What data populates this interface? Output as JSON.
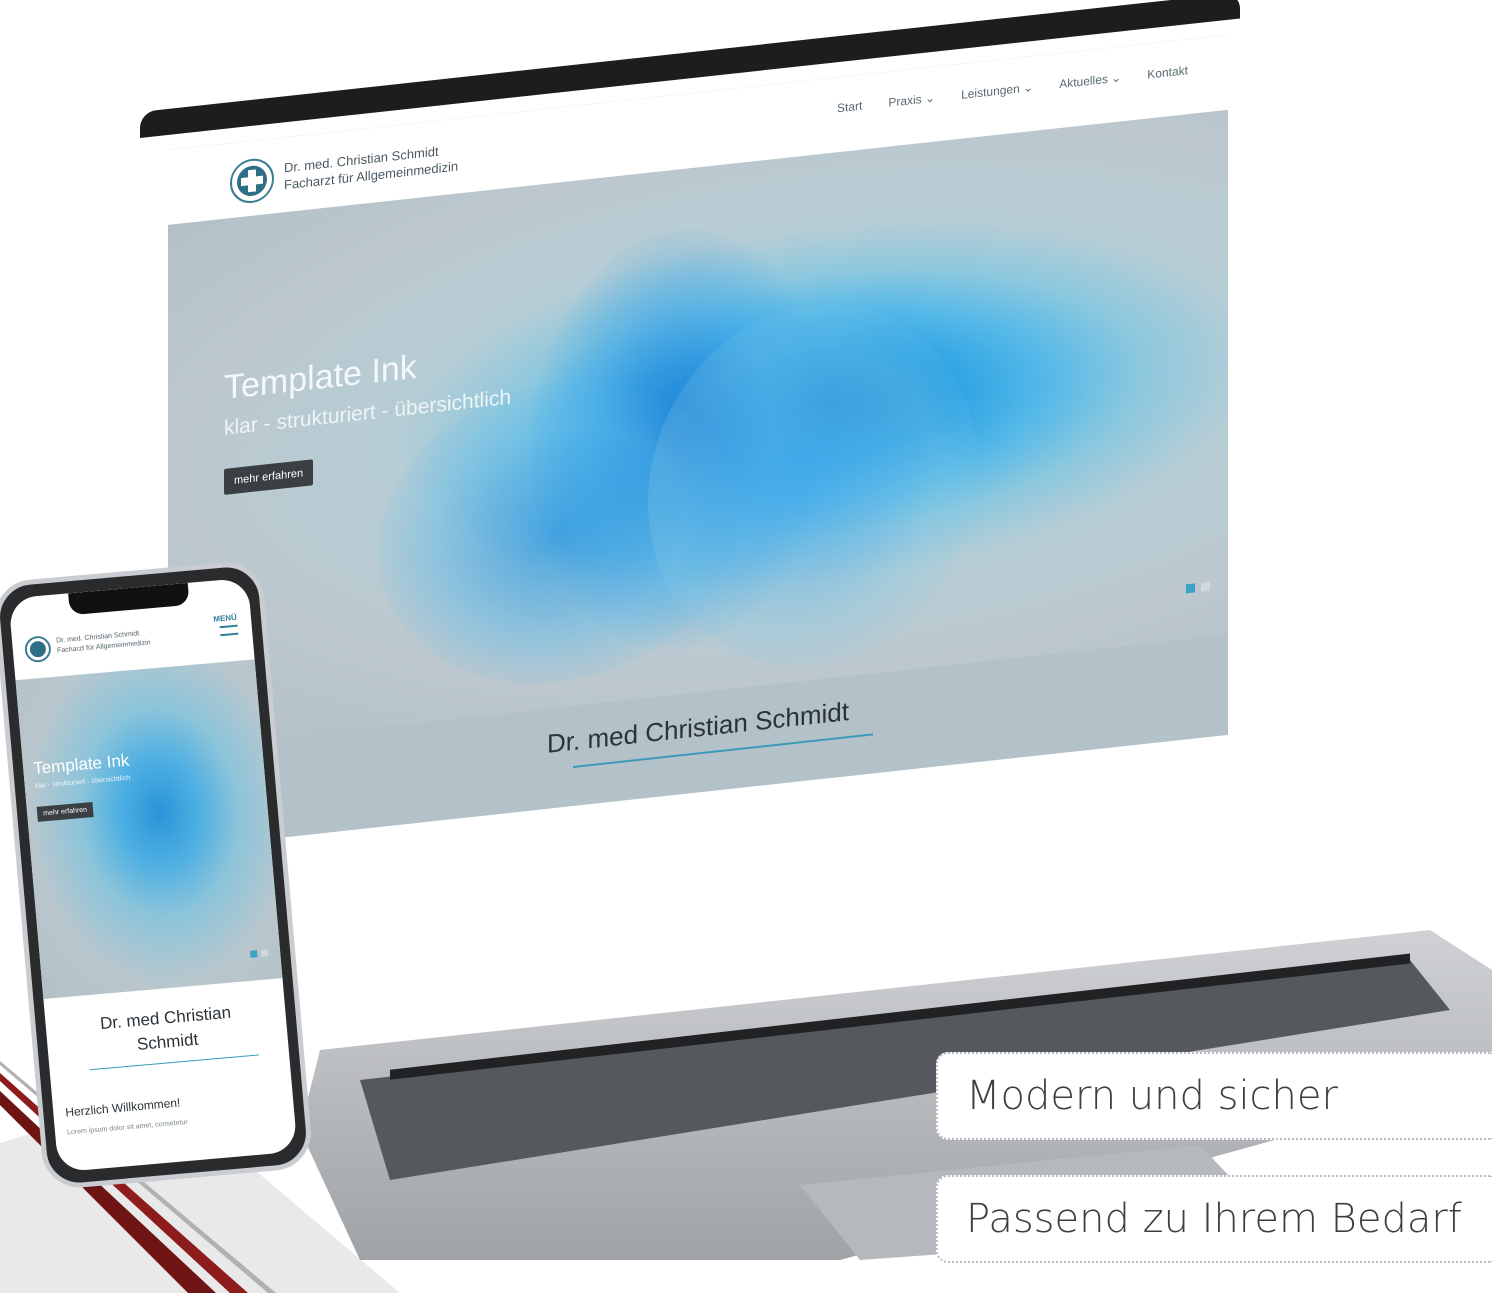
{
  "laptop_site": {
    "logo": {
      "line1": "Dr. med. Christian Schmidt",
      "line2": "Facharzt für Allgemeinmedizin"
    },
    "nav": [
      "Start",
      "Praxis",
      "Leistungen",
      "Aktuelles",
      "Kontakt"
    ],
    "nav_has_dropdown": [
      false,
      true,
      true,
      true,
      false
    ],
    "hero": {
      "title": "Template Ink",
      "subtitle": "klar - strukturiert - übersichtlich",
      "button": "mehr erfahren",
      "slides": 2,
      "active_slide": 1
    },
    "section_title": "Dr. med Christian Schmidt"
  },
  "phone_site": {
    "logo": {
      "line1": "Dr. med. Christian Schmidt",
      "line2": "Facharzt für Allgemeinmedizin"
    },
    "menu_label": "MENÜ",
    "hero": {
      "title": "Template Ink",
      "subtitle": "klar - strukturiert - übersichtlich",
      "button": "mehr erfahren"
    },
    "section_title_line1": "Dr. med Christian",
    "section_title_line2": "Schmidt",
    "welcome": "Herzlich Willkommen!",
    "lorem": "Lorem ipsum dolor sit amet, consetetur"
  },
  "callouts": [
    "Modern und sicher",
    "Passend zu Ihrem Bedarf"
  ],
  "colors": {
    "accent": "#3a9ab8",
    "logo": "#2e6f86",
    "button_bg": "#3a3f43",
    "corner_stripe": "#6e1414"
  },
  "icons": [
    "medical-cross-logo-icon",
    "chevron-down-icon",
    "hamburger-menu-icon"
  ]
}
